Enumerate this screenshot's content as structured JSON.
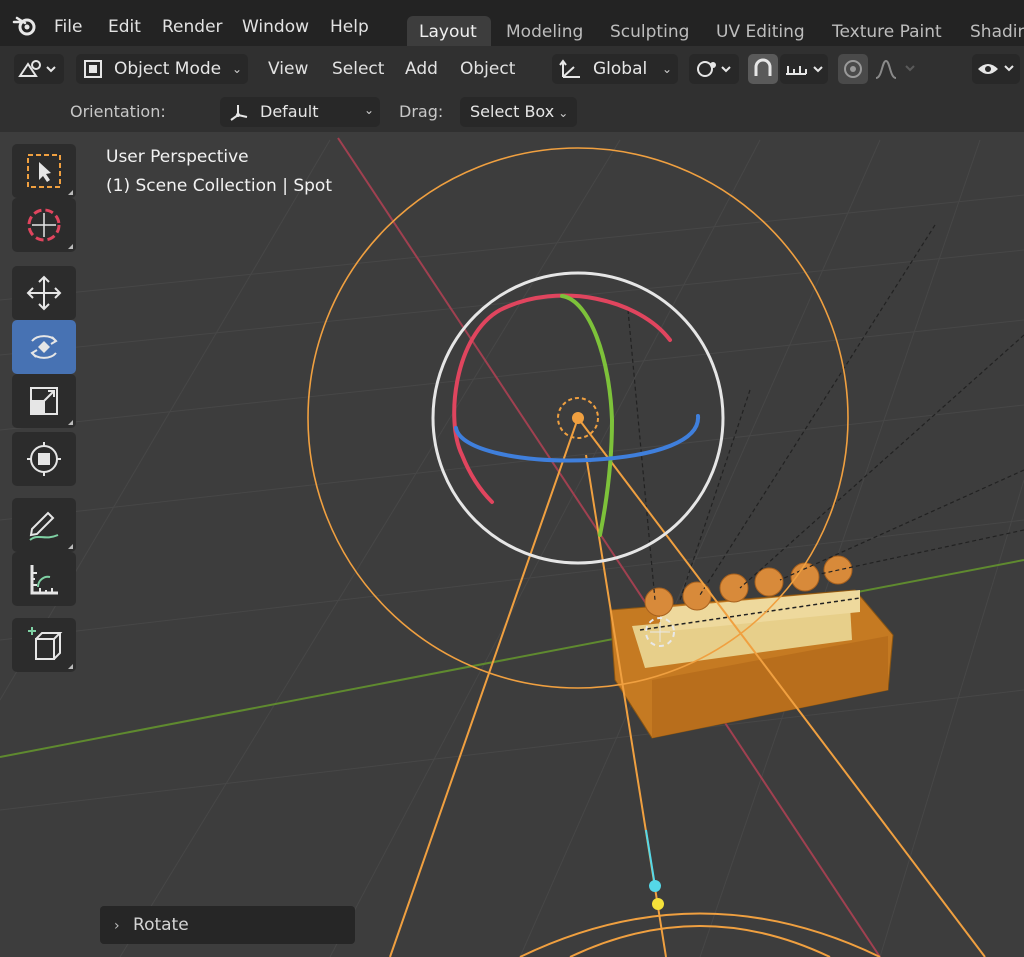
{
  "menu": {
    "file": "File",
    "edit": "Edit",
    "render": "Render",
    "window": "Window",
    "help": "Help"
  },
  "workspaces": [
    "Layout",
    "Modeling",
    "Sculpting",
    "UV Editing",
    "Texture Paint",
    "Shadin"
  ],
  "header": {
    "mode": "Object Mode",
    "view": "View",
    "select": "Select",
    "add": "Add",
    "object": "Object",
    "transform_orientation": "Global"
  },
  "tool_settings": {
    "orientation_label": "Orientation:",
    "orientation_value": "Default",
    "drag_label": "Drag:",
    "drag_value": "Select Box"
  },
  "viewport": {
    "view_name": "User Perspective",
    "collection": "(1) Scene Collection | Spot"
  },
  "toolbar": {
    "tools": [
      "select-box",
      "cursor",
      "move",
      "rotate",
      "scale",
      "transform",
      "annotate",
      "measure",
      "add-cube"
    ],
    "active": "rotate"
  },
  "operator_panel": {
    "label": "Rotate"
  },
  "colors": {
    "selection": "#f0a040",
    "x_axis": "#e0455e",
    "y_axis": "#7dc23a",
    "z_axis": "#3f7fdc",
    "active_tool": "#4772b3"
  }
}
